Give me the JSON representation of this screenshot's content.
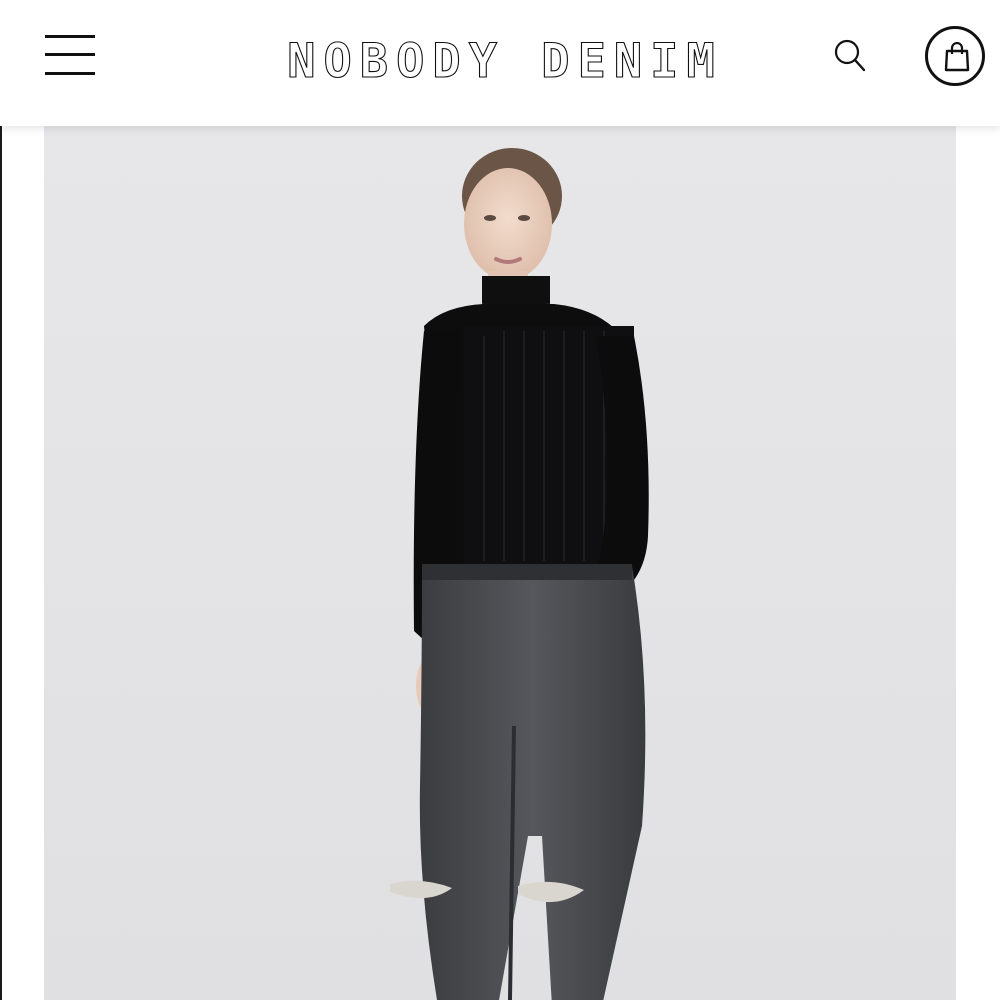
{
  "header": {
    "brand": "NOBODY DENIM",
    "menu_icon": "hamburger-menu-icon",
    "search_icon": "search-icon",
    "bag_icon": "shopping-bag-icon"
  },
  "product": {
    "image": "model-photo"
  },
  "colors": {
    "background": "#ffffff",
    "photo_background": "#e5e5e7",
    "text": "#111111"
  }
}
